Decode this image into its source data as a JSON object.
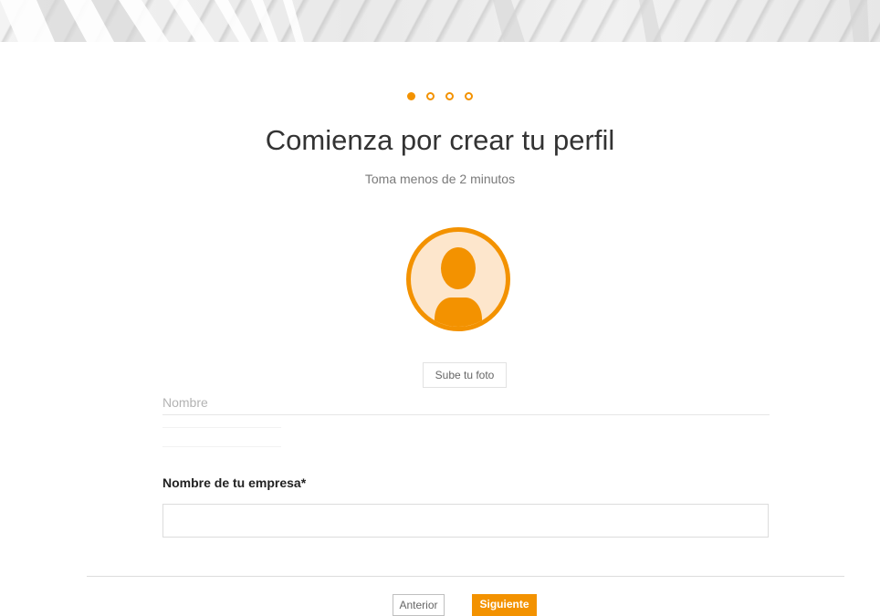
{
  "progress": {
    "current_step": 1,
    "total_steps": 4
  },
  "header": {
    "title": "Comienza por crear tu perfil",
    "subtitle": "Toma menos de 2 minutos"
  },
  "avatar": {
    "icon": "user-placeholder-icon",
    "upload_label": "Sube tu foto"
  },
  "form": {
    "name_placeholder": "Nombre",
    "company_label": "Nombre de tu empresa*",
    "company_value": ""
  },
  "footer": {
    "prev_label": "Anterior",
    "next_label": "Siguiente"
  },
  "colors": {
    "accent": "#f39200",
    "avatar_bg": "#fde6cc",
    "border": "#dcdcdc"
  }
}
